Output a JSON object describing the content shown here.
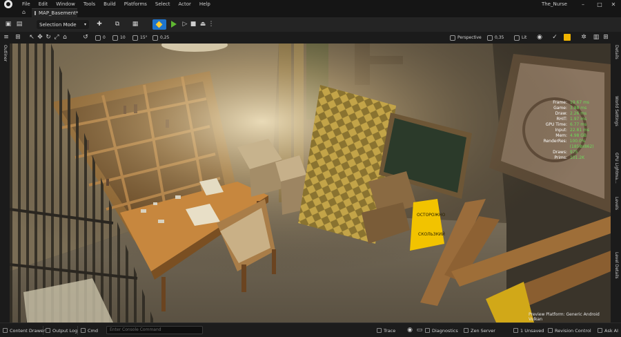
{
  "menubar": {
    "items": [
      "File",
      "Edit",
      "Window",
      "Tools",
      "Build",
      "Platforms",
      "Select",
      "Actor",
      "Help"
    ],
    "project_name": "The_Nurse",
    "minimize": "–",
    "maximize": "□",
    "close": "✕"
  },
  "tabs": {
    "home_icon": "⌂",
    "level_tab": "MAP_Basement*"
  },
  "toolbar": {
    "selection_mode": "Selection Mode",
    "chevron": "▾"
  },
  "viewport_toolbar": {
    "snap_angle_value": "0",
    "grid_value": "10",
    "rotation_snap": "15°",
    "scale_snap": "0,25",
    "perspective": "Perspective",
    "camera_speed": "0,35",
    "view_mode": "Lit"
  },
  "stats": [
    {
      "label": "Frame:",
      "value": "19.67 ms"
    },
    {
      "label": "Game:",
      "value": "3.88 ms"
    },
    {
      "label": "Draw:",
      "value": "2.26 ms"
    },
    {
      "label": "RHIT:",
      "value": "1.97 ms"
    },
    {
      "label": "GPU Time:",
      "value": "6.77 ms"
    },
    {
      "label": "Input:",
      "value": "22.81 ms"
    },
    {
      "label": "Mem:",
      "value": "4.98 GB"
    },
    {
      "label": "RenderRes:",
      "value": "100.0% (1858x862)"
    },
    {
      "label": "Draws:",
      "value": "975"
    },
    {
      "label": "Prims:",
      "value": "101.2K"
    }
  ],
  "preview_platform": "Preview Platform: Generic Android Vulkan",
  "left_tabs": [
    "Outliner"
  ],
  "right_tabs": [
    "Details",
    "World Settings",
    "GPU Lightma...",
    "Levels",
    "Level Details"
  ],
  "statusbar": {
    "content_drawer": "Content Drawer",
    "output_log": "Output Log",
    "cmd": "Cmd",
    "console_placeholder": "Enter Console Command",
    "trace": "Trace",
    "diagnostics": "Diagnostics",
    "zen_server": "Zen Server",
    "unsaved": "1 Unsaved",
    "revision_control": "Revision Control",
    "ask_ai": "Ask AI"
  },
  "colors": {
    "stat_value": "#6ddc5a",
    "play_green": "#5fb832",
    "platform_blue": "#1f74cc",
    "warning": "#f0b400"
  }
}
